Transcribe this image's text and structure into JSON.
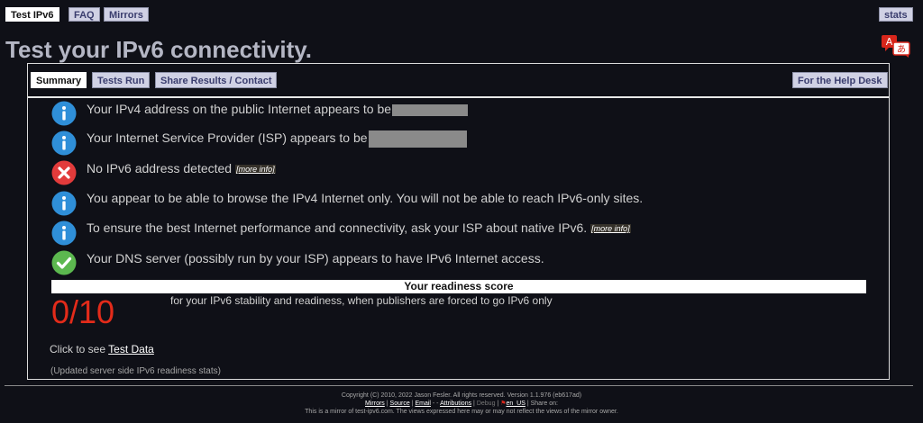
{
  "nav": {
    "tabs": [
      "Test IPv6",
      "FAQ",
      "Mirrors"
    ],
    "stats_label": "stats"
  },
  "page": {
    "title": "Test your IPv6 connectivity."
  },
  "subnav": {
    "tabs": [
      "Summary",
      "Tests Run",
      "Share Results / Contact"
    ],
    "help_desk_label": "For the Help Desk"
  },
  "results": [
    {
      "icon": "info-icon",
      "text": "Your IPv4 address on the public Internet appears to be",
      "redacted": true
    },
    {
      "icon": "info-icon",
      "text": "Your Internet Service Provider (ISP) appears to be",
      "redacted": true
    },
    {
      "icon": "error-icon",
      "text": "No IPv6 address detected",
      "more_info": "[more info]"
    },
    {
      "icon": "info-icon",
      "text": "You appear to be able to browse the IPv4 Internet only. You will not be able to reach IPv6-only sites."
    },
    {
      "icon": "info-icon",
      "text": "To ensure the best Internet performance and connectivity, ask your ISP about native IPv6.",
      "more_info": "[more info]"
    },
    {
      "icon": "check-icon",
      "text": "Your DNS server (possibly run by your ISP) appears to have IPv6 Internet access."
    }
  ],
  "score": {
    "heading": "Your readiness score",
    "value": "0/10",
    "description": "for your IPv6 stability and readiness, when publishers are forced to go IPv6 only"
  },
  "test_data": {
    "prefix": "Click to see",
    "link": "Test Data"
  },
  "updated_note": "(Updated server side IPv6 readiness stats)",
  "footer": {
    "copyright": "Copyright (C) 2010, 2022 Jason Fesler. All rights reserved. Version 1.1.976 (eb617ad)",
    "links": [
      "Mirrors",
      "Source",
      "Email",
      "Attributions"
    ],
    "debug": "Debug",
    "locale": "en_US",
    "share": "Share on:",
    "mirror_note": "This is a mirror of test-ipv6.com. The views expressed here may or may not reflect the views of the mirror owner."
  },
  "colors": {
    "background": "#0f1017",
    "info": "#2f8fd8",
    "error": "#e23b3b",
    "success": "#5cb84f",
    "score": "#e32b1a",
    "tab_bg": "#d0d1e4",
    "lang_icon": "#d7261b"
  }
}
